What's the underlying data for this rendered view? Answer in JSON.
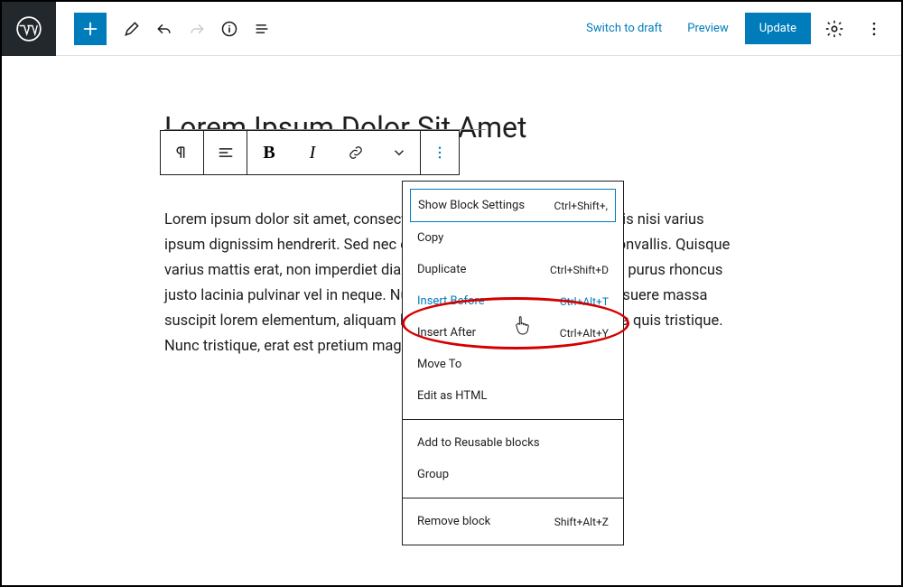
{
  "header": {
    "switch_to_draft": "Switch to draft",
    "preview": "Preview",
    "update": "Update"
  },
  "post": {
    "title": "Lorem Ipsum Dolor Sit Amet",
    "paragraph": "Lorem ipsum dolor sit amet, consectetur adipiscing elit. Aliquam mollis nisi varius ipsum dignissim hendrerit. Sed nec dolor odio. Fusce varius rutrum convallis. Quisque varius mattis erat, non imperdiet diam lacinia at. Nulla vitae enim eget purus rhoncus justo lacinia pulvinar vel in neque. Nunc vel fringilla dolor. Vivamus posuere massa suscipit lorem elementum, aliquam libero. Praesent hendrerit sed nulla quis tristique. Nunc tristique, erat est pretium magna, ut hendrerit arcu elit tortor."
  },
  "dropdown": {
    "items_a": [
      {
        "label": "Show Block Settings",
        "shortcut": "Ctrl+Shift+,"
      },
      {
        "label": "Copy",
        "shortcut": ""
      },
      {
        "label": "Duplicate",
        "shortcut": "Ctrl+Shift+D"
      },
      {
        "label": "Insert Before",
        "shortcut": "Ctrl+Alt+T"
      },
      {
        "label": "Insert After",
        "shortcut": "Ctrl+Alt+Y"
      },
      {
        "label": "Move To",
        "shortcut": ""
      },
      {
        "label": "Edit as HTML",
        "shortcut": ""
      }
    ],
    "items_b": [
      {
        "label": "Add to Reusable blocks",
        "shortcut": ""
      },
      {
        "label": "Group",
        "shortcut": ""
      }
    ],
    "items_c": [
      {
        "label": "Remove block",
        "shortcut": "Shift+Alt+Z"
      }
    ]
  }
}
